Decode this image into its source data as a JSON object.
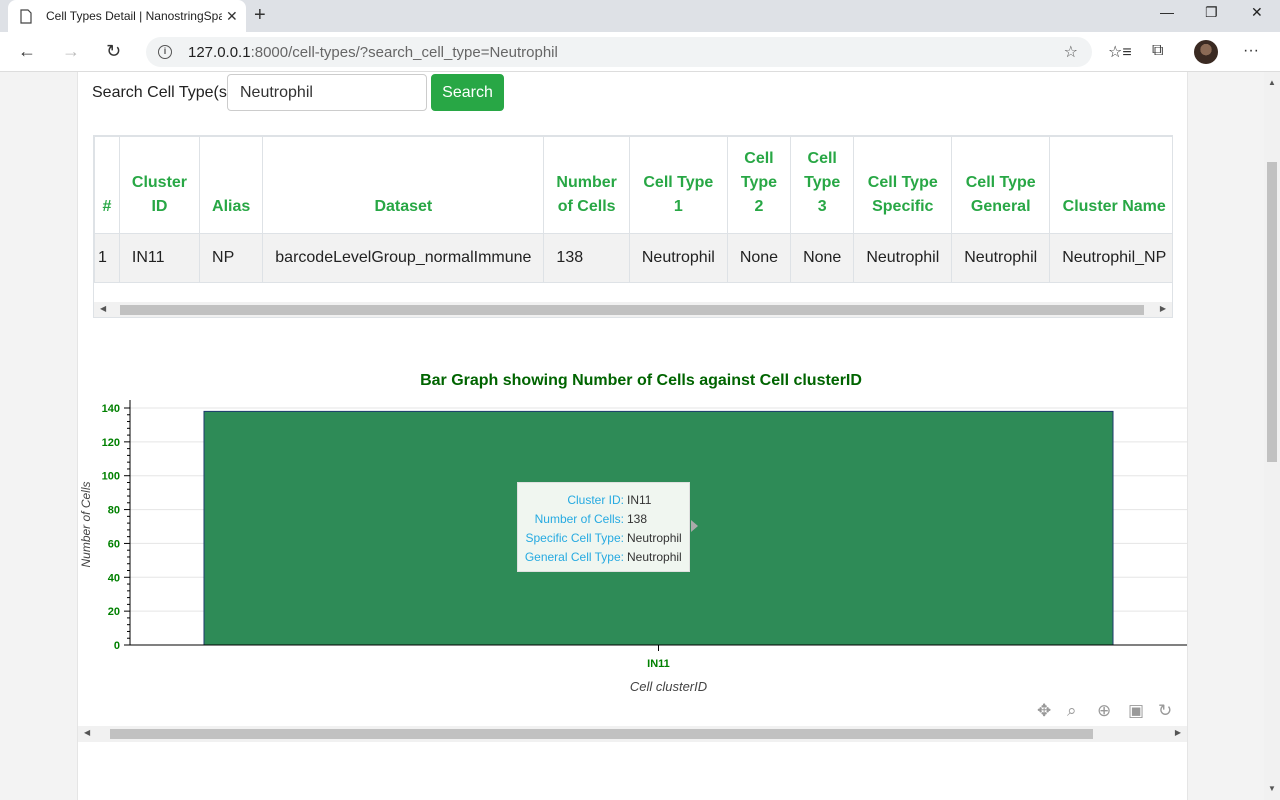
{
  "browser": {
    "tab_title": "Cell Types Detail | NanostringSpa",
    "url_host": "127.0.0.1",
    "url_rest": ":8000/cell-types/?search_cell_type=Neutrophil"
  },
  "search": {
    "label": "Search Cell Type(s):",
    "value": "Neutrophil",
    "button_label": "Search"
  },
  "table": {
    "headers": [
      "#",
      "Cluster ID",
      "Alias",
      "Dataset",
      "Number of Cells",
      "Cell Type 1",
      "Cell Type 2",
      "Cell Type 3",
      "Cell Type Specific",
      "Cell Type General",
      "Cluster Name"
    ],
    "rows": [
      [
        "1",
        "IN11",
        "NP",
        "barcodeLevelGroup_normalImmune",
        "138",
        "Neutrophil",
        "None",
        "None",
        "Neutrophil",
        "Neutrophil",
        "Neutrophil_NP"
      ]
    ]
  },
  "chart_data": {
    "type": "bar",
    "title": "Bar Graph showing Number of Cells against Cell clusterID",
    "xlabel": "Cell clusterID",
    "ylabel": "Number of Cells",
    "categories": [
      "IN11"
    ],
    "values": [
      138
    ],
    "ylim": [
      0,
      140
    ],
    "yticks": [
      0,
      20,
      40,
      60,
      80,
      100,
      120,
      140
    ],
    "grid": true,
    "bar_color": "#2e8b57",
    "axis_label_color": "#008000"
  },
  "tooltip": {
    "rows": [
      {
        "key": "Cluster ID:",
        "value": "IN11"
      },
      {
        "key": "Number of Cells:",
        "value": "138"
      },
      {
        "key": "Specific Cell Type:",
        "value": "Neutrophil"
      },
      {
        "key": "General Cell Type:",
        "value": "Neutrophil"
      }
    ]
  },
  "toolbar_icons": [
    "pan-icon",
    "box-zoom-icon",
    "wheel-zoom-icon",
    "save-icon",
    "reset-icon"
  ],
  "colors": {
    "accent_green": "#28a745",
    "title_green": "#006400",
    "tooltip_key": "#26aae1"
  }
}
